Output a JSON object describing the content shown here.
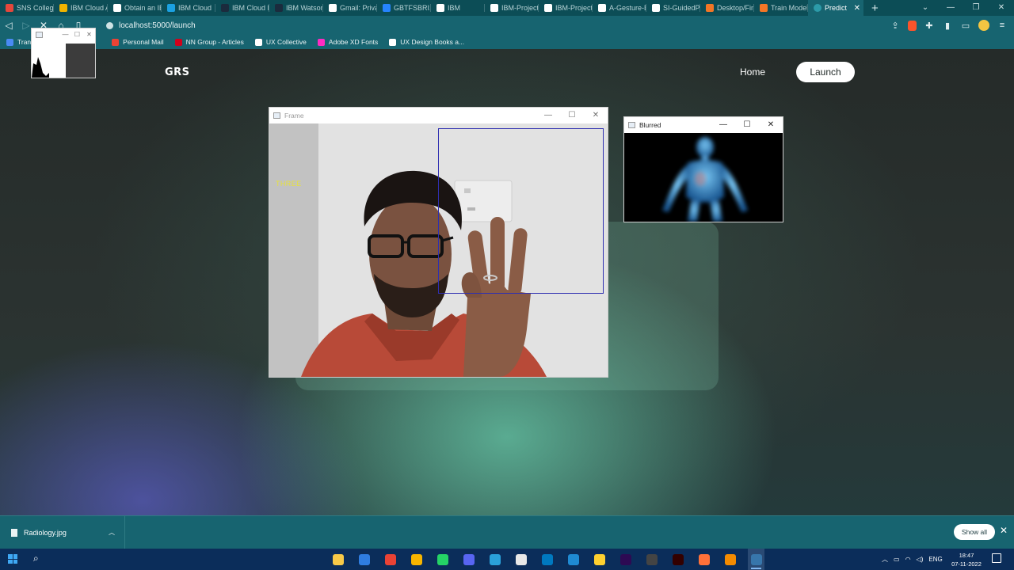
{
  "browser": {
    "tabs": [
      {
        "label": "SNS College",
        "color": "#e4473c"
      },
      {
        "label": "IBM Cloud A",
        "color": "#f0b400"
      },
      {
        "label": "Obtain an IB",
        "color": "#ffffff"
      },
      {
        "label": "IBM Cloud",
        "color": "#1ba1e2"
      },
      {
        "label": "IBM Cloud P",
        "color": "#1b2b3d"
      },
      {
        "label": "IBM Watson",
        "color": "#1b2b3d"
      },
      {
        "label": "Gmail: Privat",
        "color": "#ffffff"
      },
      {
        "label": "GBTFSBRI11 -",
        "color": "#2684ff"
      },
      {
        "label": "IBM",
        "color": "#ffffff"
      },
      {
        "label": "IBM-Project",
        "color": "#ffffff"
      },
      {
        "label": "IBM-Project",
        "color": "#ffffff"
      },
      {
        "label": "A-Gesture-B",
        "color": "#ffffff"
      },
      {
        "label": "SI-GuidedPr",
        "color": "#ffffff"
      },
      {
        "label": "Desktop/Fin",
        "color": "#f37626"
      },
      {
        "label": "Train Model",
        "color": "#f37626"
      }
    ],
    "active_tab": "Predict",
    "url": "localhost:5000/launch",
    "bookmarks": [
      {
        "label": "Tran",
        "color": "#4a8af4"
      },
      {
        "label": "Personal Mail",
        "color": "#ea4335"
      },
      {
        "label": "NN Group - Articles",
        "color": "#d0021b"
      },
      {
        "label": "UX Collective",
        "color": "#ffffff"
      },
      {
        "label": "Adobe XD Fonts",
        "color": "#ff2bc2"
      },
      {
        "label": "UX Design Books a...",
        "color": "#ffffff"
      }
    ]
  },
  "site": {
    "logo": "GRS",
    "nav": {
      "home": "Home",
      "launch": "Launch"
    }
  },
  "windows": {
    "frame": {
      "title": "Frame",
      "overlay_text": "THREE"
    },
    "blurred": {
      "title": "Blurred"
    }
  },
  "downloads": {
    "file": "Radiology.jpg",
    "show_all": "Show all"
  },
  "taskbar": {
    "apps": [
      {
        "name": "file-explorer",
        "color": "#f7c948"
      },
      {
        "name": "app-2",
        "color": "#2f7de1"
      },
      {
        "name": "chrome",
        "color": "#e94235"
      },
      {
        "name": "chrome-2",
        "color": "#f7b500"
      },
      {
        "name": "whatsapp",
        "color": "#25d366"
      },
      {
        "name": "discord",
        "color": "#5865f2"
      },
      {
        "name": "telegram",
        "color": "#2aa1da"
      },
      {
        "name": "app-8",
        "color": "#e8e8e8"
      },
      {
        "name": "trello",
        "color": "#0079bf"
      },
      {
        "name": "vscode",
        "color": "#1f8ad2"
      },
      {
        "name": "miro",
        "color": "#ffd02f"
      },
      {
        "name": "premiere",
        "color": "#2d0a53"
      },
      {
        "name": "app-13",
        "color": "#444444"
      },
      {
        "name": "illustrator",
        "color": "#330000"
      },
      {
        "name": "firefox",
        "color": "#ff7139"
      },
      {
        "name": "vlc",
        "color": "#f48b00"
      },
      {
        "name": "python",
        "color": "#3776ab"
      }
    ],
    "language": "ENG",
    "time": "18:47",
    "date": "07-11-2022"
  }
}
